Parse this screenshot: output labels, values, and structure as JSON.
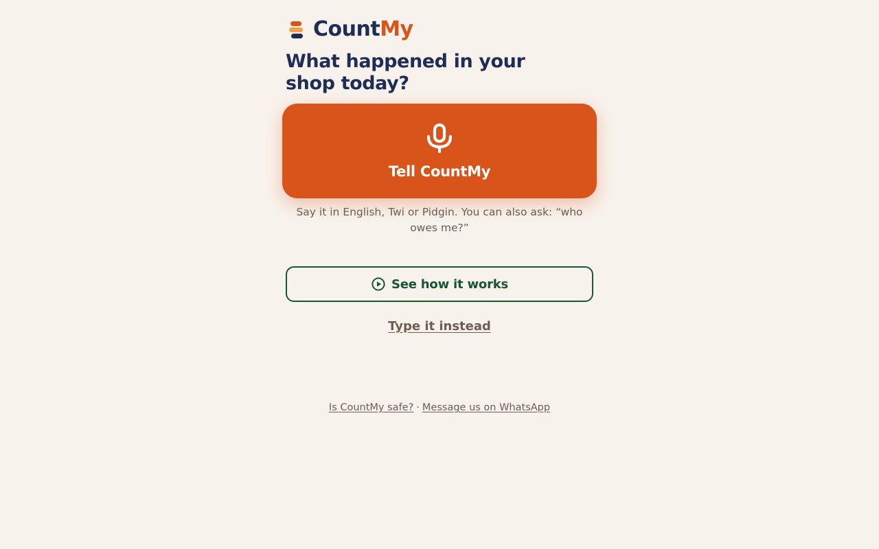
{
  "brand": {
    "name_part1": "Count",
    "name_part2": "My",
    "colors": {
      "navy": "#1d2d55",
      "orange": "#d9531b",
      "amber": "#f0a24a"
    }
  },
  "main": {
    "title": "What happened in your shop today?",
    "tell_button": {
      "label": "Tell CountMy",
      "icon": "microphone-icon",
      "color": "#d8541b"
    },
    "hint": "Say it in English, Twi or Pidgin. You can also ask: “who owes me?”",
    "how_button": {
      "label": "See how it works",
      "icon": "play-circle-icon",
      "color": "#175630"
    },
    "type_link": "Type it instead"
  },
  "footer": {
    "safe_link": "Is CountMy safe?",
    "separator": "·",
    "whatsapp_link": "Message us on WhatsApp"
  }
}
